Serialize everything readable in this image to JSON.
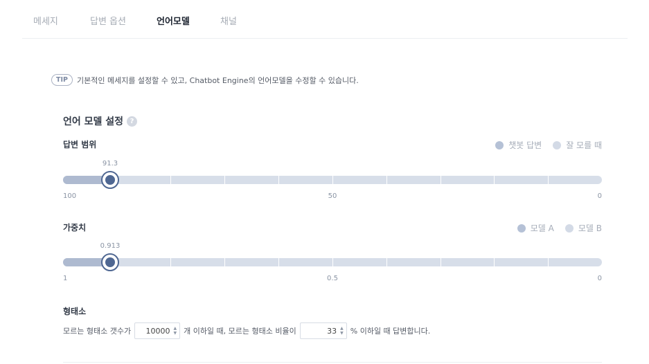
{
  "tabs": [
    {
      "label": "메세지",
      "active": false
    },
    {
      "label": "답변 옵션",
      "active": false
    },
    {
      "label": "언어모델",
      "active": true
    },
    {
      "label": "채널",
      "active": false
    }
  ],
  "tip": {
    "badge": "TIP",
    "text": "기본적인 메세지를 설정할 수 있고, Chatbot Engine의 언어모델을 수정할 수 있습니다."
  },
  "section": {
    "title": "언어 모델 설정",
    "help_icon": "question-mark",
    "help_glyph": "?"
  },
  "answer_range": {
    "label": "답변 범위",
    "legend": [
      {
        "label": "챗봇 답변",
        "color": "#b5c1d6"
      },
      {
        "label": "잘 모를 때",
        "color": "#d3dae6"
      }
    ],
    "value_label": "91.3",
    "value": 91.3,
    "min": 0,
    "max": 100,
    "scale": [
      "100",
      "50",
      "0"
    ]
  },
  "weight": {
    "label": "가중치",
    "legend": [
      {
        "label": "모델 A",
        "color": "#b5c1d6"
      },
      {
        "label": "모델 B",
        "color": "#d3dae6"
      }
    ],
    "value_label": "0.913",
    "value": 0.913,
    "min": 0,
    "max": 1,
    "scale": [
      "1",
      "0.5",
      "0"
    ]
  },
  "morpheme": {
    "label": "형태소",
    "text_before": "모르는 형태소 갯수가",
    "count_value": "10000",
    "text_middle": "개 이하일 때, 모르는 형태소 비율이",
    "ratio_value": "33",
    "text_after": "% 이하일 때 답변합니다."
  }
}
